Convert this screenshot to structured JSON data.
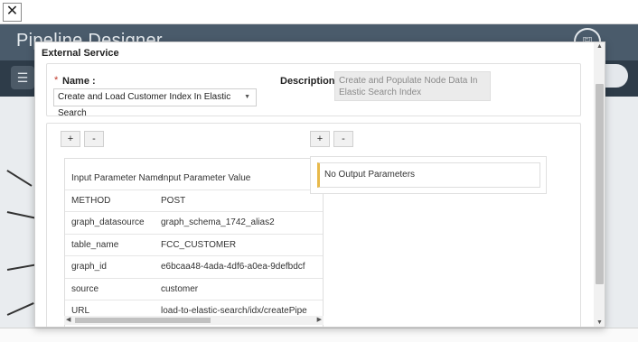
{
  "window": {
    "close_glyph": "✕",
    "close_icon": "close-icon"
  },
  "app": {
    "title": "Pipeline Designer",
    "menu_icon": "hamburger-menu-icon",
    "save_icon": "save-icon"
  },
  "modal": {
    "title": "External Service",
    "name_label": "Name :",
    "required_mark": "*",
    "name_value": "Create and Load Customer Index In Elastic Search",
    "description_label": "Description :",
    "description_value": "Create and Populate Node Data In Elastic Search Index",
    "input_params": {
      "add_label": "+",
      "remove_label": "-",
      "headers": [
        "Input Parameter Name",
        "Input Parameter Value"
      ],
      "rows": [
        {
          "name": "METHOD",
          "value": "POST"
        },
        {
          "name": "graph_datasource",
          "value": "graph_schema_1742_alias2"
        },
        {
          "name": "table_name",
          "value": "FCC_CUSTOMER"
        },
        {
          "name": "graph_id",
          "value": "e6bcaa48-4ada-4df6-a0ea-9defbdcf"
        },
        {
          "name": "source",
          "value": "customer"
        },
        {
          "name": "URL",
          "value": "load-to-elastic-search/idx/createPipe"
        }
      ]
    },
    "output_params": {
      "add_label": "+",
      "remove_label": "-",
      "empty_text": "No Output Parameters"
    }
  },
  "colors": {
    "header": "#4a5b6b",
    "toolbar": "#2e3c49",
    "canvas": "#e9ecef",
    "empty_accent": "#e8b94a"
  }
}
